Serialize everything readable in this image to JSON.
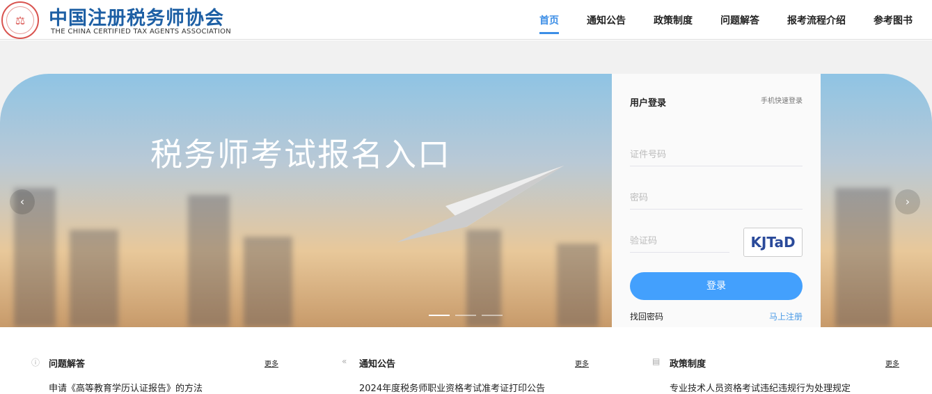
{
  "header": {
    "logo_cn": "中国注册税务师协会",
    "logo_en": "THE CHINA CERTIFIED TAX AGENTS ASSOCIATION",
    "nav": [
      "首页",
      "通知公告",
      "政策制度",
      "问题解答",
      "报考流程介绍",
      "参考图书"
    ],
    "active": "首页"
  },
  "banner": {
    "title": "税务师考试报名入口",
    "slides": 3,
    "active_slide": 1
  },
  "login": {
    "title": "用户登录",
    "quick_login": "手机快速登录",
    "id_placeholder": "证件号码",
    "password_placeholder": "密码",
    "captcha_placeholder": "验证码",
    "captcha_text": "KJTaD",
    "submit": "登录",
    "forgot": "找回密码",
    "register": "马上注册"
  },
  "sections": [
    {
      "title": "问题解答",
      "icon": "question-icon",
      "more": "更多",
      "items": [
        "申请《高等教育学历认证报告》的方法"
      ]
    },
    {
      "title": "通知公告",
      "icon": "double-chevron-left-icon",
      "more": "更多",
      "items": [
        "2024年度税务师职业资格考试准考证打印公告"
      ]
    },
    {
      "title": "政策制度",
      "icon": "document-icon",
      "more": "更多",
      "items": [
        "专业技术人员资格考试违纪违规行为处理规定"
      ]
    }
  ]
}
